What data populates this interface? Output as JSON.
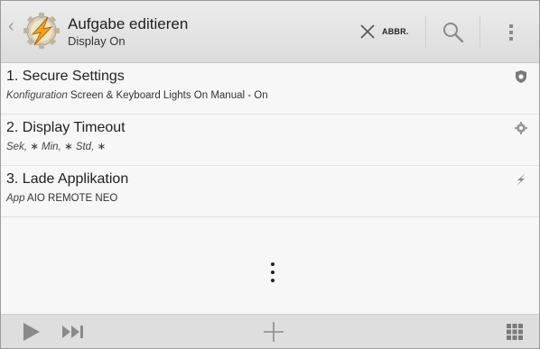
{
  "header": {
    "title": "Aufgabe editieren",
    "subtitle": "Display On",
    "cancel_label": "ABBR.",
    "icons": {
      "back": "chevron-left-icon",
      "app": "tasker-lightning-icon",
      "cancel": "close-icon",
      "search": "search-icon",
      "overflow": "overflow-menu-icon"
    }
  },
  "actions": [
    {
      "title": "1.  Secure Settings",
      "param_label": "Konfiguration",
      "param_value": "Screen & Keyboard Lights On Manual - On",
      "icon": "shield-icon"
    },
    {
      "title": "2.  Display Timeout",
      "param_parts": [
        {
          "text": "Sek,",
          "italic": true
        },
        {
          "text": " ∗ ",
          "italic": false
        },
        {
          "text": "Min,",
          "italic": true
        },
        {
          "text": " ∗ ",
          "italic": false
        },
        {
          "text": "Std,",
          "italic": true
        },
        {
          "text": " ∗",
          "italic": false
        }
      ],
      "icon": "gear-icon"
    },
    {
      "title": "3.  Lade Applikation",
      "param_label": "App",
      "param_value": "AIO REMOTE NEO",
      "icon": "lightning-icon"
    }
  ],
  "more_icon": "more-vertical-icon",
  "bottom_bar": {
    "icons": [
      "play-icon",
      "skip-forward-icon",
      "add-icon",
      "grid-icon"
    ]
  },
  "colors": {
    "actionbar": "#e3e3e3",
    "background": "#f7f7f7",
    "bottombar": "#dedede",
    "icon_gray": "#8a8a8a"
  }
}
